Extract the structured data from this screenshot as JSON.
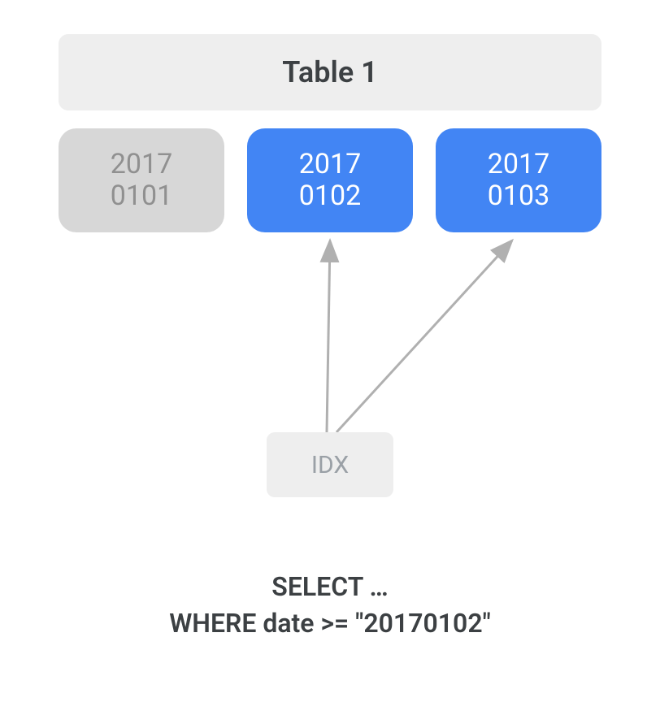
{
  "table": {
    "title": "Table 1",
    "partitions": [
      {
        "line1": "2017",
        "line2": "0101",
        "selected": false
      },
      {
        "line1": "2017",
        "line2": "0102",
        "selected": true
      },
      {
        "line1": "2017",
        "line2": "0103",
        "selected": true
      }
    ]
  },
  "index": {
    "label": "IDX"
  },
  "sql": {
    "line1": "SELECT …",
    "line2": "WHERE date >= \"20170102\""
  },
  "colors": {
    "gray_bg": "#d7d7d7",
    "gray_text": "#909090",
    "blue_bg": "#4285f4",
    "light_bg": "#eeeeee",
    "dark_text": "#3c4043",
    "muted_text": "#9aa0a6",
    "arrow": "#b0b0b0"
  }
}
